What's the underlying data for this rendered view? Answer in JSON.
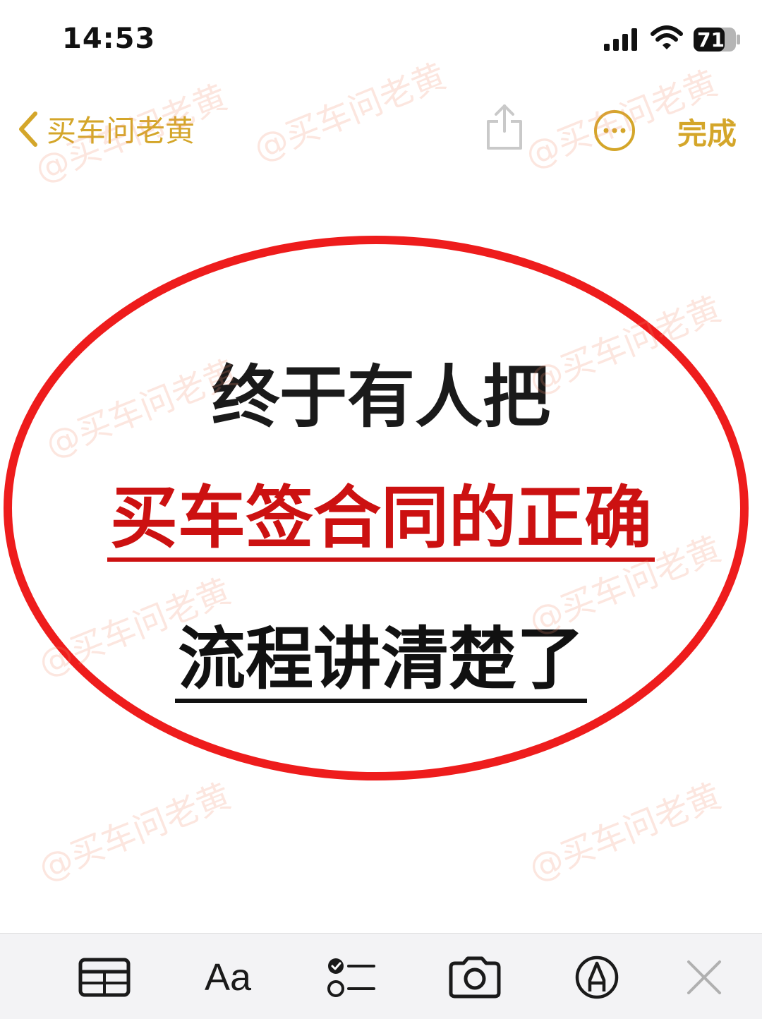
{
  "status_bar": {
    "time": "14:53",
    "battery": "71"
  },
  "nav": {
    "back_label": "买车问老黄",
    "done_label": "完成"
  },
  "note": {
    "line1": "终于有人把",
    "line2": "买车签合同的正确",
    "line3": "流程讲清楚了"
  },
  "watermark_text": "@买车问老黄",
  "toolbar": {
    "format_label": "Aa"
  },
  "colors": {
    "accent": "#d4a62a",
    "red": "#cc1111",
    "toolbar_bg": "#f3f3f5"
  }
}
